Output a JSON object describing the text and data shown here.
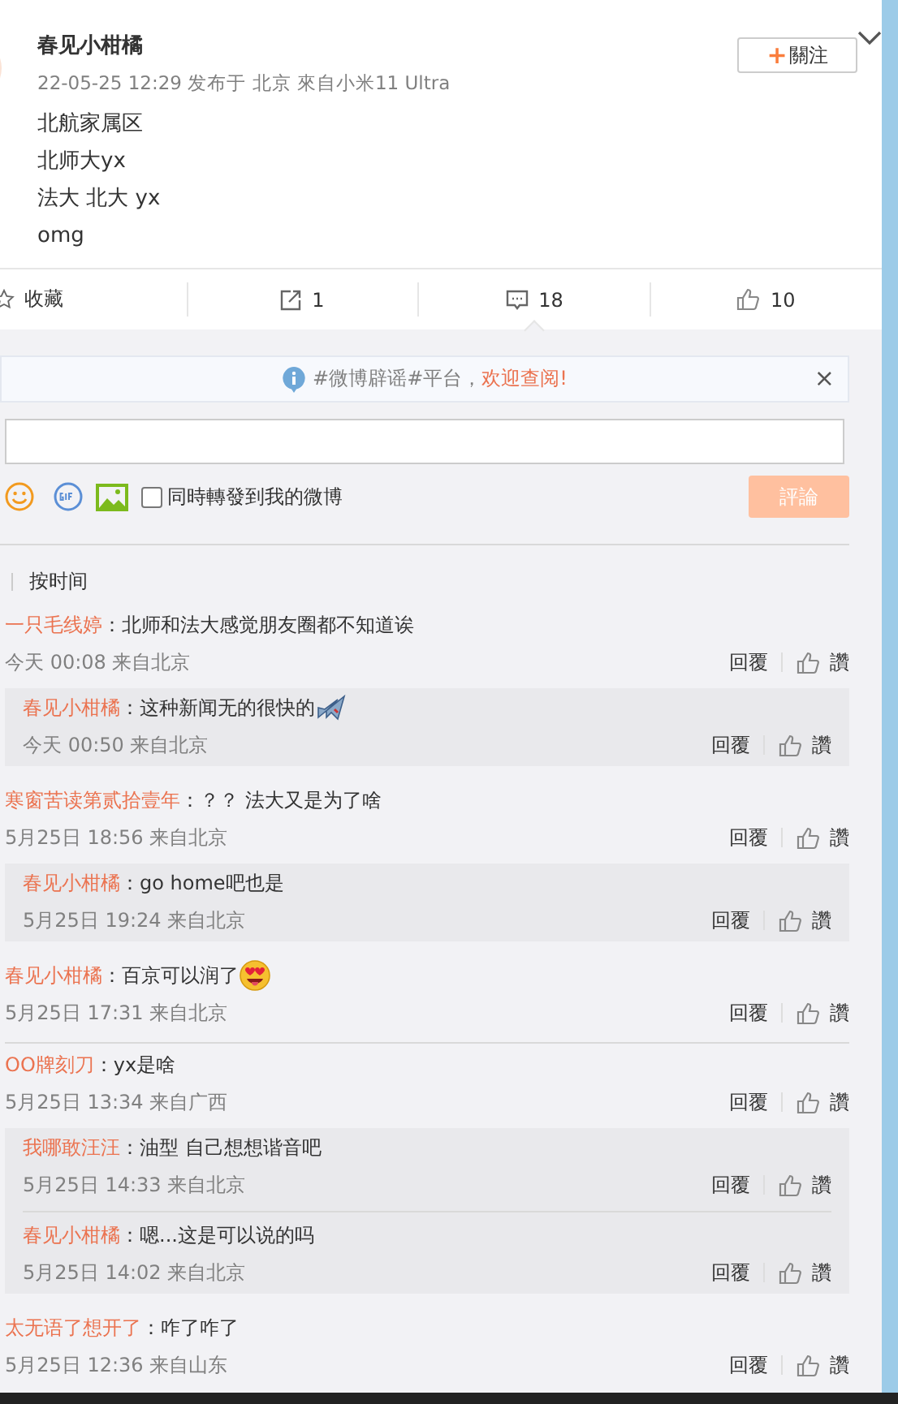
{
  "post": {
    "author": "春见小柑橘",
    "meta": "22-05-25 12:29 发布于 北京 來自小米11 Ultra",
    "lines": [
      "北航家属区",
      "北师大yx",
      "法大 北大 yx",
      "omg"
    ],
    "follow_button": {
      "icon": "+",
      "label": "關注"
    }
  },
  "actions": [
    {
      "kind": "favorite",
      "label": "收藏",
      "selected": false
    },
    {
      "kind": "repost",
      "label": "1",
      "selected": false
    },
    {
      "kind": "comment",
      "label": "18",
      "selected": true
    },
    {
      "kind": "like",
      "label": "10",
      "selected": false
    }
  ],
  "notice": {
    "text": "#微博辟谣#平台，",
    "link": "欢迎查阅!",
    "close": "×"
  },
  "composer": {
    "repost_checkbox": {
      "label": "同時轉發到我的微博",
      "checked": false
    },
    "submit": {
      "label": "評論",
      "disabled": true
    }
  },
  "sort_label": "按时间",
  "comments": [
    {
      "user": "一只毛线婷",
      "kind": "plain",
      "text": "：北师和法大感觉朋友圈都不知道诶",
      "time": "今天 00:08 来自北京",
      "reply": "回覆",
      "like": "讚",
      "replies": [
        {
          "user": "春见小柑橘",
          "kind": "airplane",
          "text": "：这种新闻无的很快的",
          "time": "今天 00:50 来自北京",
          "reply": "回覆",
          "like": "讚"
        }
      ]
    },
    {
      "user": "寒窗苦读第贰拾壹年",
      "kind": "plain",
      "text": "：？？ 法大又是为了啥",
      "time": "5月25日 18:56 来自北京",
      "reply": "回覆",
      "like": "讚",
      "replies": [
        {
          "user": "春见小柑橘",
          "kind": "plain",
          "text": "：go home吧也是",
          "time": "5月25日 19:24 来自北京",
          "reply": "回覆",
          "like": "讚"
        }
      ]
    },
    {
      "user": "春见小柑橘",
      "kind": "hearteyes",
      "text": "：百京可以润了",
      "time": "5月25日 17:31 来自北京",
      "reply": "回覆",
      "like": "讚"
    },
    {
      "user": "OO牌刻刀",
      "kind": "plain",
      "text": "：yx是啥",
      "time": "5月25日 13:34 来自广西",
      "reply": "回覆",
      "like": "讚",
      "replies": [
        {
          "user": "我哪敢汪汪",
          "kind": "plain",
          "text": "：油型 自己想想谐音吧",
          "time": "5月25日 14:33 来自北京",
          "reply": "回覆",
          "like": "讚"
        },
        {
          "user": "春见小柑橘",
          "kind": "plain",
          "text": "：嗯...这是可以说的吗",
          "time": "5月25日 14:02 来自北京",
          "reply": "回覆",
          "like": "讚"
        }
      ]
    },
    {
      "user": "太无语了想开了",
      "kind": "plain",
      "text": "：咋了咋了",
      "time": "5月25日 12:36 来自山东",
      "reply": "回覆",
      "like": "讚"
    }
  ]
}
